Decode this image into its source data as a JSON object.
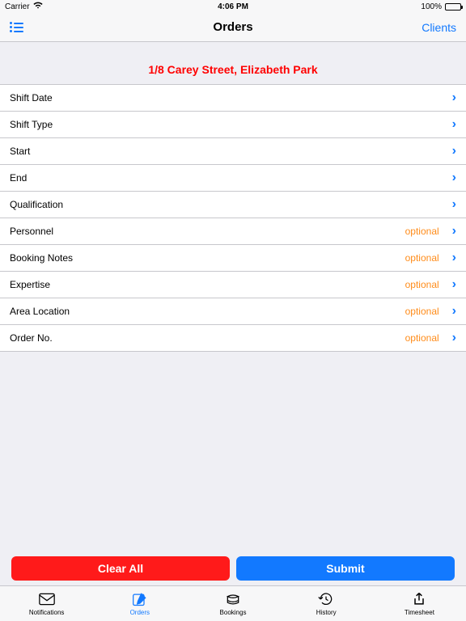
{
  "status": {
    "carrier": "Carrier",
    "time": "4:06 PM",
    "battery": "100%"
  },
  "nav": {
    "title": "Orders",
    "right": "Clients"
  },
  "address": "1/8 Carey Street, Elizabeth Park",
  "rows": [
    {
      "label": "Shift Date",
      "value": ""
    },
    {
      "label": "Shift Type",
      "value": ""
    },
    {
      "label": "Start",
      "value": ""
    },
    {
      "label": "End",
      "value": ""
    },
    {
      "label": "Qualification",
      "value": ""
    },
    {
      "label": "Personnel",
      "value": "optional"
    },
    {
      "label": "Booking Notes",
      "value": "optional"
    },
    {
      "label": "Expertise",
      "value": "optional"
    },
    {
      "label": "Area Location",
      "value": "optional"
    },
    {
      "label": "Order No.",
      "value": "optional"
    }
  ],
  "buttons": {
    "clear": "Clear All",
    "submit": "Submit"
  },
  "tabs": [
    {
      "label": "Notifications"
    },
    {
      "label": "Orders"
    },
    {
      "label": "Bookings"
    },
    {
      "label": "History"
    },
    {
      "label": "Timesheet"
    }
  ]
}
